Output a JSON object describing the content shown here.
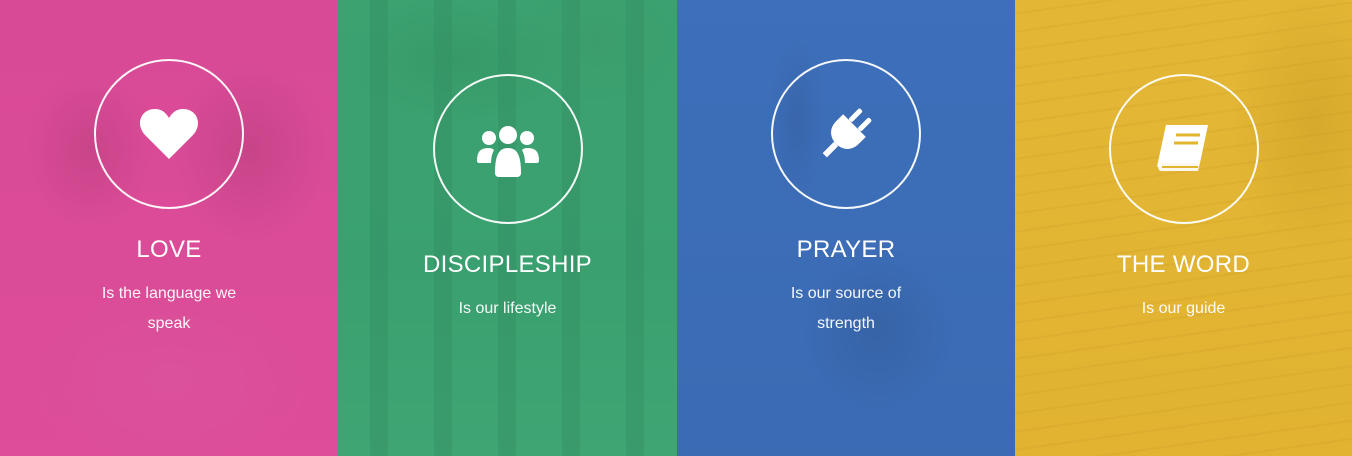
{
  "features": [
    {
      "title": "LOVE",
      "description": "Is the language we speak",
      "icon": "heart-icon",
      "tint": "#e0489a"
    },
    {
      "title": "DISCIPLESHIP",
      "description": "Is our lifestyle",
      "icon": "users-icon",
      "tint": "#3aa978"
    },
    {
      "title": "PRAYER",
      "description": "Is our source of strength",
      "icon": "plug-icon",
      "tint": "#3d6db8"
    },
    {
      "title": "THE WORD",
      "description": "Is our guide",
      "icon": "book-icon",
      "tint": "#e1b62e"
    }
  ]
}
